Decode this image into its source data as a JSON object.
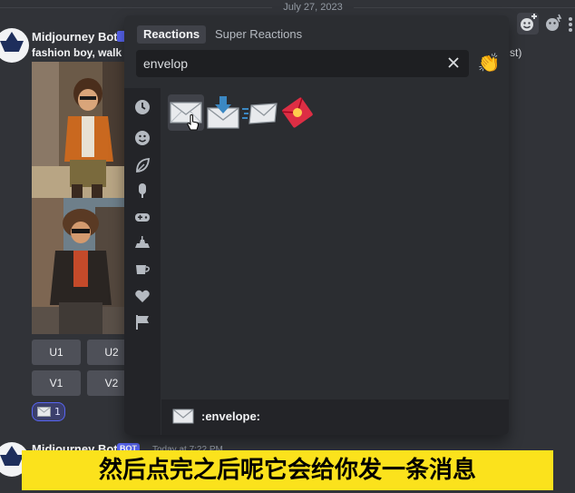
{
  "date_divider": "July 27, 2023",
  "message1": {
    "author": "Midjourney Bot",
    "prompt_preview": "fashion boy, walk",
    "prompt_tail": "st)",
    "upscale_buttons": [
      "U1",
      "U2"
    ],
    "variation_buttons": [
      "V1",
      "V2"
    ],
    "reaction": {
      "emoji": "envelope",
      "count": "1"
    }
  },
  "message2": {
    "author": "Midjourney Bot",
    "badge": "BOT",
    "timestamp": "Today at 7:22 PM"
  },
  "picker": {
    "tabs": [
      {
        "label": "Reactions",
        "active": true
      },
      {
        "label": "Super Reactions",
        "active": false
      }
    ],
    "search_value": "envelop",
    "categories": [
      "recent-icon",
      "smile-icon",
      "nature-icon",
      "food-icon",
      "activity-icon",
      "travel-icon",
      "objects-icon",
      "symbols-icon",
      "flags-icon"
    ],
    "results": [
      {
        "name": "envelope",
        "hovered": true
      },
      {
        "name": "envelope_with_arrow",
        "hovered": false
      },
      {
        "name": "incoming_envelope",
        "hovered": false
      },
      {
        "name": "red_envelope",
        "hovered": false
      }
    ],
    "footer_name": ":envelope:"
  },
  "subtitle": "然后点完之后呢它会给你发一条消息",
  "colors": {
    "background": "#313338",
    "picker": "#2b2d31",
    "accent": "#5865f2",
    "subtitle_bg": "#fbe21c"
  }
}
